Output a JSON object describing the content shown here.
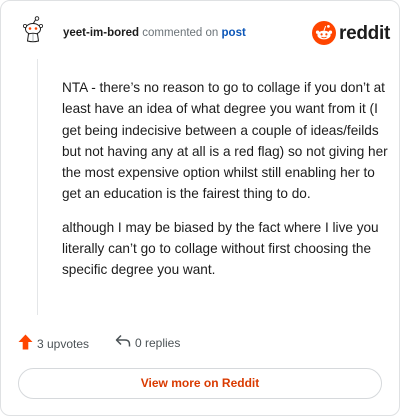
{
  "header": {
    "username": "yeet-im-bored",
    "action_text": "commented on",
    "post_link": "post",
    "brand": "reddit",
    "avatar_icon": "reddit-snoo-avatar-icon",
    "logo_icon": "reddit-logo-icon"
  },
  "comment": {
    "paragraphs": [
      "NTA - there’s no reason to go to collage if you don’t at least have an idea of what degree you want from it (I get being indecisive between a couple of ideas/feilds but not having any at all is a red flag) so not giving her the most expensive option whilst still enabling her to get an education is the fairest thing to do.",
      "although I may be biased by the fact where I live you literally can’t go to collage without first choosing the specific degree you want."
    ]
  },
  "actions": {
    "upvotes_label": "3 upvotes",
    "upvote_icon": "upvote-arrow-icon",
    "replies_label": "0 replies",
    "reply_icon": "reply-arrow-icon"
  },
  "footer": {
    "view_more_label": "View more on Reddit"
  },
  "colors": {
    "brand_orange": "#ff4500",
    "link_blue": "#0b56b8",
    "cta_text": "#d93a00",
    "text_primary": "#1c1c1c",
    "text_secondary": "#6b7378"
  }
}
